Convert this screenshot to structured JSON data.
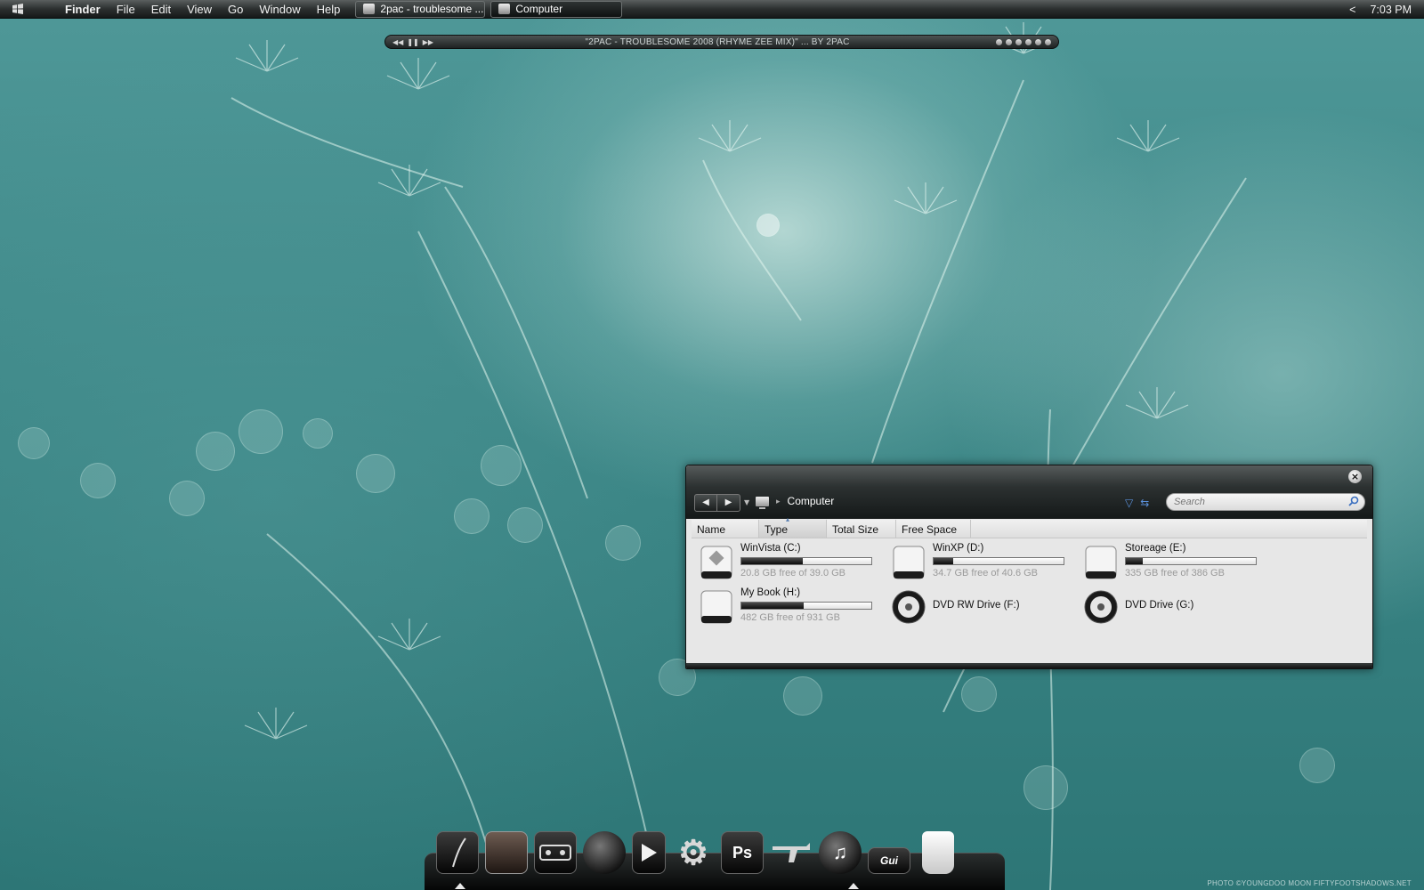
{
  "menubar": {
    "app_name": "Finder",
    "menus": [
      "File",
      "Edit",
      "View",
      "Go",
      "Window",
      "Help"
    ],
    "tasks": [
      {
        "label": "2pac - troublesome ..."
      },
      {
        "label": "Computer"
      }
    ],
    "clock": "7:03 PM",
    "tray_arrow": "<"
  },
  "media_bar": {
    "track_title": "\"2PAC - TROUBLESOME 2008 (RHYME ZEE MIX)\" ... BY 2PAC"
  },
  "explorer": {
    "close_glyph": "×",
    "breadcrumb": "Computer",
    "search_placeholder": "Search",
    "columns": [
      "Name",
      "Type",
      "Total Size",
      "Free Space"
    ],
    "drives": [
      {
        "name": "WinVista (C:)",
        "free_text": "20.8 GB free of 39.0 GB",
        "used_fraction": 0.47,
        "kind": "hdd-windows"
      },
      {
        "name": "WinXP (D:)",
        "free_text": "34.7 GB free of 40.6 GB",
        "used_fraction": 0.15,
        "kind": "hdd"
      },
      {
        "name": "Storeage (E:)",
        "free_text": "335 GB free of 386 GB",
        "used_fraction": 0.13,
        "kind": "hdd"
      },
      {
        "name": "My Book (H:)",
        "free_text": "482 GB free of 931 GB",
        "used_fraction": 0.48,
        "kind": "hdd"
      },
      {
        "name": "DVD RW Drive (F:)",
        "free_text": "",
        "used_fraction": null,
        "kind": "dvd"
      },
      {
        "name": "DVD Drive (G:)",
        "free_text": "",
        "used_fraction": null,
        "kind": "dvd"
      }
    ]
  },
  "dock": {
    "items": [
      {
        "name": "dock-app-1-icon"
      },
      {
        "name": "dock-photo-icon"
      },
      {
        "name": "dock-app-3-icon"
      },
      {
        "name": "dock-firefox-icon"
      },
      {
        "name": "dock-media-player-icon"
      },
      {
        "name": "dock-settings-icon"
      },
      {
        "name": "dock-photoshop-icon",
        "label": "Ps"
      },
      {
        "name": "dock-app-8-icon"
      },
      {
        "name": "dock-itunes-icon"
      },
      {
        "name": "dock-app-10-icon",
        "label": "Gui"
      },
      {
        "name": "dock-trash-icon"
      }
    ]
  },
  "credit": "PHOTO ©YOUNGDOO MOON   FIFTYFOOTSHADOWS.NET"
}
